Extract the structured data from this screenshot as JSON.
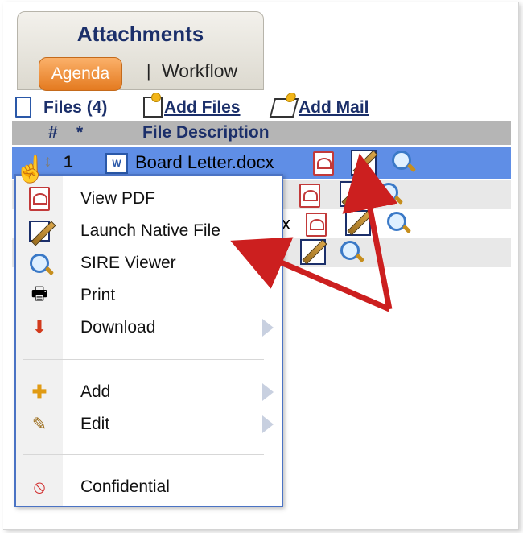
{
  "panel": {
    "title": "Attachments",
    "tab_active": "Agenda",
    "tab_separator": "|",
    "tab_other": "Workflow"
  },
  "files_bar": {
    "files_count": "Files (4)",
    "add_files": "Add Files",
    "add_mail": "Add Mail"
  },
  "grid": {
    "headers": {
      "num": "#",
      "star": "*",
      "desc": "File Description"
    },
    "selected_row": {
      "num": "1",
      "file": "Board Letter.docx"
    },
    "partial_row_text": "x"
  },
  "context_menu": {
    "items": [
      {
        "label": "View PDF",
        "icon": "pdf-icon"
      },
      {
        "label": "Launch Native File",
        "icon": "pencil-icon"
      },
      {
        "label": "SIRE Viewer",
        "icon": "magnifier-icon"
      },
      {
        "label": "Print",
        "icon": "printer-icon"
      },
      {
        "label": "Download",
        "icon": "download-icon",
        "submenu": true
      },
      {
        "label": "Add",
        "icon": "plus-icon",
        "submenu": true
      },
      {
        "label": "Edit",
        "icon": "pencil-icon",
        "submenu": true
      },
      {
        "label": "Confidential",
        "icon": "confidential-icon"
      }
    ]
  },
  "colors": {
    "accent": "#e47a1f",
    "selection": "#5f8ee6",
    "title": "#1b2f6a",
    "arrow": "#cc1f1f"
  }
}
